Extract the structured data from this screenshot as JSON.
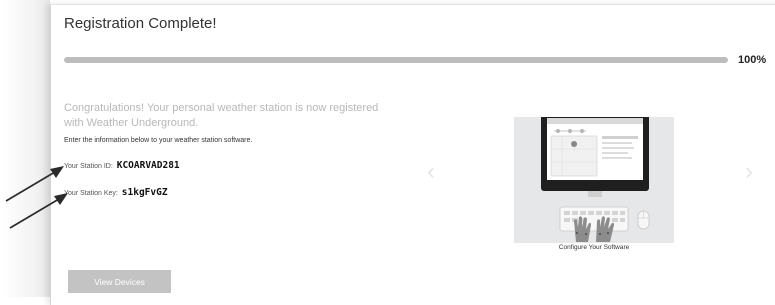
{
  "page": {
    "title": "Registration Complete!"
  },
  "progress": {
    "value_fraction": 1.0,
    "label": "100%"
  },
  "congratulations_text": "Congratulations! Your personal weather station is now registered with Weather Underground.",
  "instructions_text": "Enter the information below to your weather station software.",
  "station_id": {
    "label": "Your Station ID:",
    "value": "KCOARVAD281"
  },
  "station_key": {
    "label": "Your Station Key:",
    "value": "s1kgFvGZ"
  },
  "illustration": {
    "icon": "computer-software-setup-icon",
    "caption": "Configure Your Software"
  },
  "carousel": {
    "prev_icon": "chevron-left-icon",
    "next_icon": "chevron-right-icon"
  },
  "buttons": {
    "view_devices": "View Devices"
  },
  "colors": {
    "progress_fill": "#bdbdbd",
    "progress_track": "#e4e4e4",
    "button_bg": "#c3c3c3",
    "illustration_bg": "#e6e7e8",
    "monitor_frame": "#1f1f1f"
  }
}
